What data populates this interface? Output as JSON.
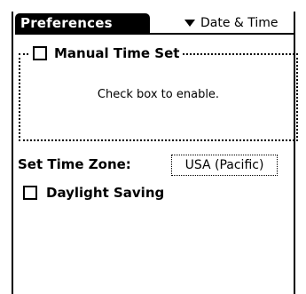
{
  "app": {
    "title": "Preferences"
  },
  "category": {
    "selected": "Date & Time"
  },
  "manual_time": {
    "label": "Manual Time Set",
    "checked": false,
    "hint": "Check box to enable."
  },
  "time_zone": {
    "label": "Set Time Zone:",
    "value": "USA (Pacific)"
  },
  "daylight_saving": {
    "label": "Daylight Saving",
    "checked": false
  }
}
